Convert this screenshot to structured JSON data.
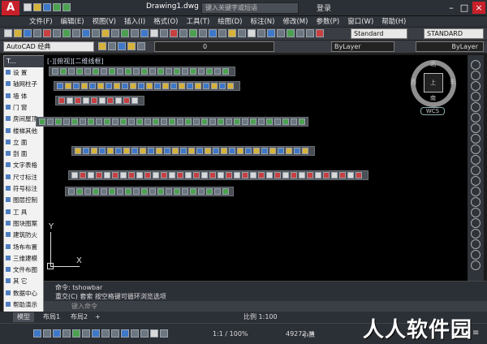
{
  "app": {
    "logo": "A",
    "document_title": "Drawing1.dwg",
    "search_placeholder": "键入关键字或短语",
    "login": "登录"
  },
  "menu": [
    "文件(F)",
    "编辑(E)",
    "视图(V)",
    "插入(I)",
    "格式(O)",
    "工具(T)",
    "绘图(D)",
    "标注(N)",
    "修改(M)",
    "参数(P)",
    "窗口(W)",
    "帮助(H)"
  ],
  "toolbar": {
    "workspace": "AutoCAD 经典",
    "text_style": "Standard",
    "dim_style": "STANDARD",
    "layer": "0",
    "color": "ByLayer",
    "linetype": "ByLayer",
    "lineweight": "ByLayer"
  },
  "palette": {
    "title": "T...",
    "items": [
      "设  置",
      "轴网柱子",
      "墙  体",
      "门  窗",
      "房间屋顶",
      "楼梯其他",
      "立  面",
      "剖  面",
      "文字表格",
      "尺寸标注",
      "符号标注",
      "图层控制",
      "工  具",
      "图块图案",
      "建筑防火",
      "场布布置",
      "三维建模",
      "文件布图",
      "其  它",
      "数据中心",
      "帮助演示"
    ]
  },
  "canvas": {
    "viewport_label": "[-][俯视][二维线框]",
    "viewcube": {
      "north": "北",
      "south": "南",
      "east": "东",
      "west": "西",
      "top": "上"
    },
    "wcs": "WCS",
    "axis_x": "X",
    "axis_y": "Y"
  },
  "command": {
    "line1": "命令: tshowbar",
    "line2": "重交(C) 套索  按空格键可循环浏览选项",
    "prompt": "键入命令"
  },
  "tabs": [
    "模型",
    "布局1",
    "布局2"
  ],
  "status": {
    "scale": "比例 1:100",
    "coords": "49272, 4",
    "annotation_scale": "1:1 / 100%",
    "sub": "小数"
  },
  "watermark": "人人软件园",
  "colors": {
    "accent": "#c8202a",
    "canvas": "#000000",
    "chrome": "#2b2f36"
  }
}
